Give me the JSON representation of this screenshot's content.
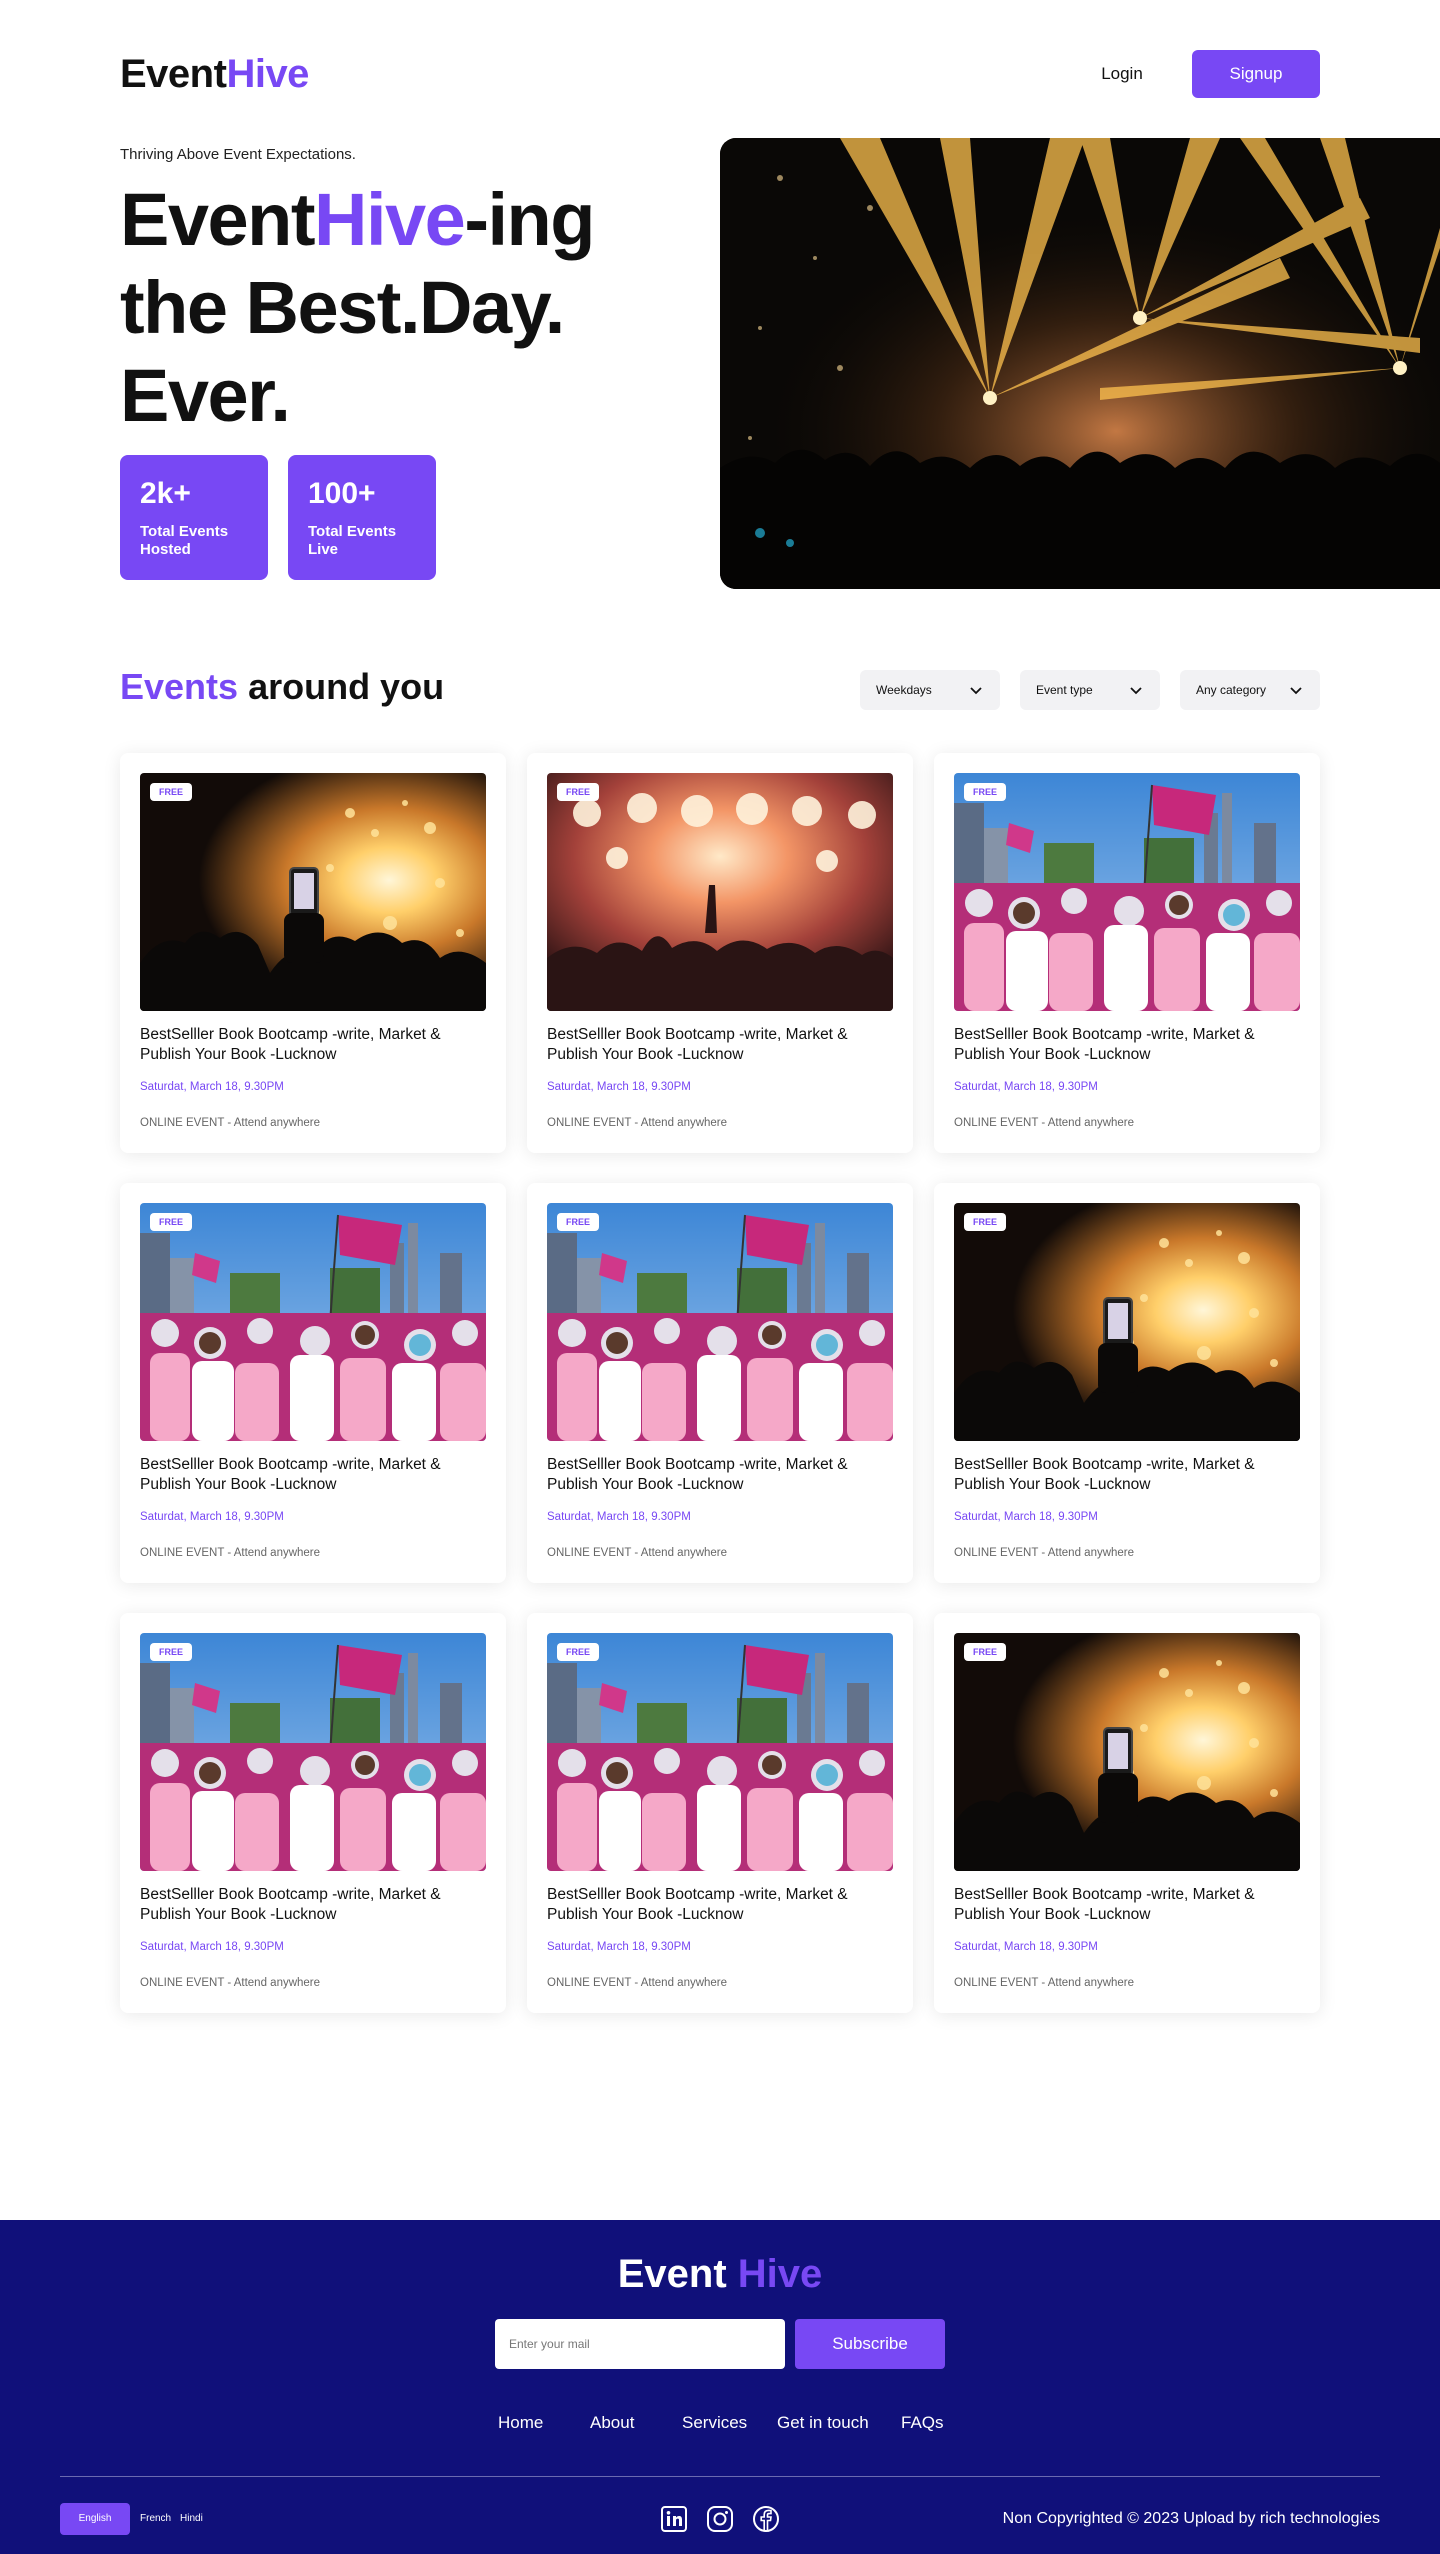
{
  "header": {
    "logo_part1": "Event",
    "logo_part2": "Hive",
    "login_label": "Login",
    "signup_label": "Signup"
  },
  "hero": {
    "tagline": "Thriving Above Event Expectations.",
    "title_part1": "Event",
    "title_accent": "Hive",
    "title_part2": "-ing",
    "title_line2": "the Best.Day.",
    "title_line3": "Ever.",
    "stats": [
      {
        "value": "2k+",
        "label": "Total Events Hosted"
      },
      {
        "value": "100+",
        "label": "Total Events Live"
      }
    ]
  },
  "events_section": {
    "title_accent": "Events",
    "title_rest": " around you",
    "filters": [
      {
        "label": "Weekdays",
        "icon": "chevron-down-icon"
      },
      {
        "label": "Event type",
        "icon": "chevron-down-icon"
      },
      {
        "label": "Any category",
        "icon": "chevron-down-icon"
      }
    ]
  },
  "events": [
    {
      "badge": "FREE",
      "title": "BestSelller Book Bootcamp -write, Market & Publish Your Book -Lucknow",
      "date": "Saturdat, March 18, 9.30PM",
      "location": "ONLINE EVENT - Attend anywhere",
      "image": "fireworks-phone"
    },
    {
      "badge": "FREE",
      "title": "BestSelller Book Bootcamp -write, Market & Publish Your Book -Lucknow",
      "date": "Saturdat, March 18, 9.30PM",
      "location": "ONLINE EVENT - Attend anywhere",
      "image": "concert-lights"
    },
    {
      "badge": "FREE",
      "title": "BestSelller Book Bootcamp -write, Market & Publish Your Book -Lucknow",
      "date": "Saturdat, March 18, 9.30PM",
      "location": "ONLINE EVENT - Attend anywhere",
      "image": "pink-flag-crowd"
    },
    {
      "badge": "FREE",
      "title": "BestSelller Book Bootcamp -write, Market & Publish Your Book -Lucknow",
      "date": "Saturdat, March 18, 9.30PM",
      "location": "ONLINE EVENT - Attend anywhere",
      "image": "pink-flag-crowd"
    },
    {
      "badge": "FREE",
      "title": "BestSelller Book Bootcamp -write, Market & Publish Your Book -Lucknow",
      "date": "Saturdat, March 18, 9.30PM",
      "location": "ONLINE EVENT - Attend anywhere",
      "image": "pink-flag-crowd"
    },
    {
      "badge": "FREE",
      "title": "BestSelller Book Bootcamp -write, Market & Publish Your Book -Lucknow",
      "date": "Saturdat, March 18, 9.30PM",
      "location": "ONLINE EVENT - Attend anywhere",
      "image": "fireworks-phone"
    },
    {
      "badge": "FREE",
      "title": "BestSelller Book Bootcamp -write, Market & Publish Your Book -Lucknow",
      "date": "Saturdat, March 18, 9.30PM",
      "location": "ONLINE EVENT - Attend anywhere",
      "image": "pink-flag-crowd"
    },
    {
      "badge": "FREE",
      "title": "BestSelller Book Bootcamp -write, Market & Publish Your Book -Lucknow",
      "date": "Saturdat, March 18, 9.30PM",
      "location": "ONLINE EVENT - Attend anywhere",
      "image": "pink-flag-crowd"
    },
    {
      "badge": "FREE",
      "title": "BestSelller Book Bootcamp -write, Market & Publish Your Book -Lucknow",
      "date": "Saturdat, March 18, 9.30PM",
      "location": "ONLINE EVENT - Attend anywhere",
      "image": "fireworks-phone"
    }
  ],
  "footer": {
    "logo_part1": "Event",
    "logo_part2": "Hive",
    "email_placeholder": "Enter your mail",
    "subscribe_label": "Subscribe",
    "nav": [
      "Home",
      "About",
      "Services",
      "Get in touch",
      "FAQs"
    ],
    "languages": [
      "English",
      "French",
      "Hindi"
    ],
    "active_language": "English",
    "social_icons": [
      "linkedin-icon",
      "instagram-icon",
      "facebook-icon"
    ],
    "copyright": "Non Copyrighted © 2023 Upload by rich technologies"
  },
  "colors": {
    "accent": "#7848f4",
    "footer_bg": "#10107a",
    "text": "#111111"
  }
}
